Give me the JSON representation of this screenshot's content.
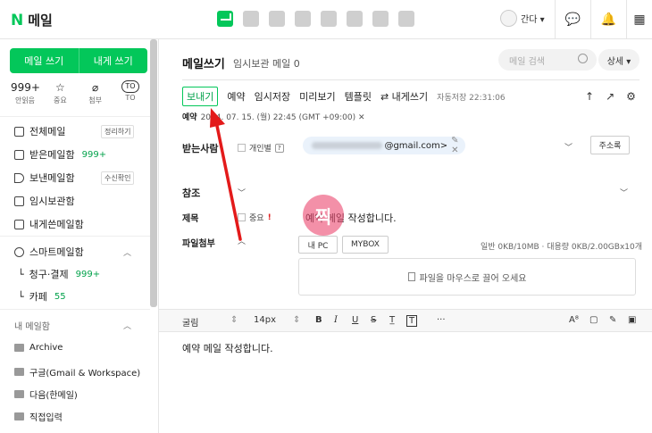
{
  "header": {
    "logo_letter": "N",
    "logo_text": "메일",
    "user_name": "간다 ▾",
    "apps": [
      "mail-app",
      "calendar-app",
      "memo-app",
      "contacts-app",
      "mybox-app",
      "todo-app",
      "home-app",
      "office-app"
    ]
  },
  "sidebar": {
    "compose": "메일 쓰기",
    "compose_self": "내게 쓰기",
    "quick": [
      {
        "big": "999+",
        "label": "안읽음"
      },
      {
        "big": "☆",
        "label": "중요"
      },
      {
        "big": "⌀",
        "label": "첨부"
      },
      {
        "big": "TO",
        "label": "TO"
      }
    ],
    "folders": [
      {
        "label": "전체메일",
        "tag": "정리하기"
      },
      {
        "label": "받은메일함",
        "count": "999+"
      },
      {
        "label": "보낸메일함",
        "tag": "수신확인"
      },
      {
        "label": "임시보관함"
      },
      {
        "label": "내게쓴메일함"
      }
    ],
    "smart": {
      "label": "스마트메일함",
      "sub": [
        {
          "label": "청구·결제",
          "count": "999+"
        },
        {
          "label": "카페",
          "count": "55"
        }
      ]
    },
    "my_section": "내 메일함",
    "my_folders": [
      "Archive",
      "구글(Gmail & Workspace)",
      "다음(한메일)",
      "직접입력"
    ]
  },
  "main": {
    "title": "메일쓰기",
    "subtitle": "임시보관 메일 0",
    "search_placeholder": "메일 검색",
    "detail": "상세 ▾",
    "toolbar": {
      "send": "보내기",
      "schedule": "예약",
      "save": "임시저장",
      "preview": "미리보기",
      "template": "템플릿",
      "self": "⇄ 내게쓰기",
      "autosave": "자동저장 22:31:06"
    },
    "schedule_label": "예약",
    "schedule_value": "2024. 07. 15. (월) 22:45 (GMT +09:00) ✕",
    "to_label": "받는사람",
    "individual": "개인별",
    "recipient": "@gmail.com>",
    "recipient_actions": "✎ ✕",
    "address_book": "주소록",
    "cc_label": "참조",
    "subject_label": "제목",
    "important": "중요",
    "important_mark": "!",
    "subject_value": "예약 메일 작성합니다.",
    "attach_label": "파일첨부",
    "my_pc": "내 PC",
    "mybox": "MYBOX",
    "attach_info": "일반 0KB/10MB · 대용량 0KB/2.00GBx10개",
    "drop_text": "파일을 마우스로 끌어 오세요",
    "editor": {
      "font": "굴림",
      "size": "14px",
      "bold": "B",
      "italic": "I",
      "underline": "U",
      "strike": "S",
      "more": "···"
    },
    "body": "예약 메일 작성합니다.",
    "stamp": "찍"
  }
}
